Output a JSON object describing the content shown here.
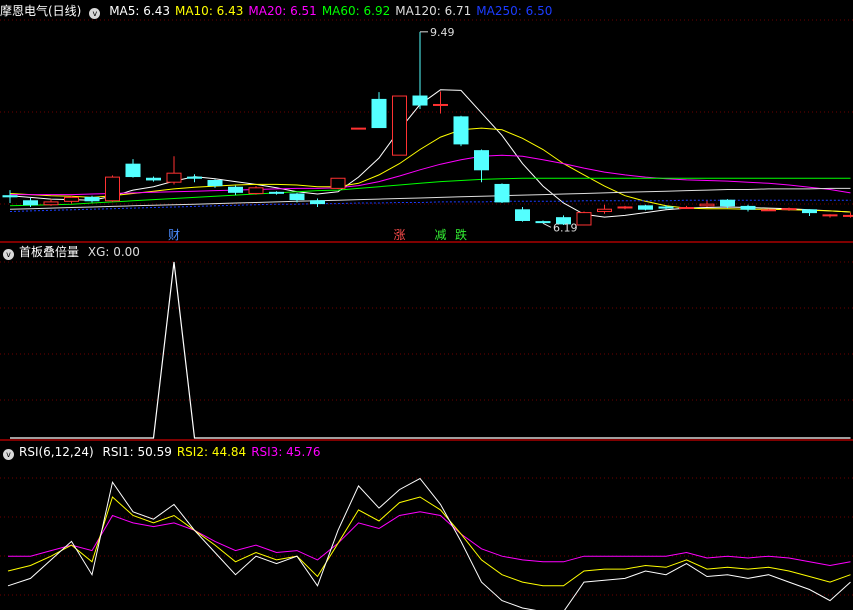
{
  "panels": {
    "main": {
      "title": "摩恩电气(日线)",
      "indicators": [
        {
          "label": "MA5:",
          "value": "6.43",
          "color": "#ffffff"
        },
        {
          "label": "MA10:",
          "value": "6.43",
          "color": "#ffff00"
        },
        {
          "label": "MA20:",
          "value": "6.51",
          "color": "#ff00ff"
        },
        {
          "label": "MA60:",
          "value": "6.92",
          "color": "#00ff00"
        },
        {
          "label": "MA120:",
          "value": "6.71",
          "color": "#dddddd"
        },
        {
          "label": "MA250:",
          "value": "6.50",
          "color": "#1c3cff"
        }
      ]
    },
    "volume": {
      "title": "首板叠倍量",
      "indicators": [
        {
          "label": "XG:",
          "value": "0.00",
          "color": "#dddddd"
        }
      ]
    },
    "rsi": {
      "title": "RSI(6,12,24)",
      "indicators": [
        {
          "label": "RSI1:",
          "value": "50.59",
          "color": "#ffffff"
        },
        {
          "label": "RSI2:",
          "value": "44.84",
          "color": "#ffff00"
        },
        {
          "label": "RSI3:",
          "value": "45.76",
          "color": "#ff00ff"
        }
      ]
    }
  },
  "icons": {
    "collapse": "chevron-down-icon"
  },
  "colors": {
    "up": "#ff3232",
    "down": "#54ffff",
    "grid": "#6e0000",
    "border": "#aa0000"
  },
  "chart_data": [
    {
      "type": "candlestick",
      "ylim": [
        5.9,
        9.7
      ],
      "candles": [
        [
          6.58,
          6.56,
          6.68,
          6.45
        ],
        [
          6.49,
          6.42,
          6.54,
          6.38
        ],
        [
          6.42,
          6.47,
          6.52,
          6.4
        ],
        [
          6.48,
          6.55,
          6.58,
          6.44
        ],
        [
          6.55,
          6.49,
          6.58,
          6.46
        ],
        [
          6.49,
          6.91,
          6.94,
          6.47
        ],
        [
          7.14,
          6.92,
          7.23,
          6.9
        ],
        [
          6.89,
          6.86,
          6.92,
          6.83
        ],
        [
          6.82,
          6.98,
          7.28,
          6.78
        ],
        [
          6.91,
          6.89,
          6.96,
          6.82
        ],
        [
          6.85,
          6.76,
          6.87,
          6.72
        ],
        [
          6.73,
          6.64,
          6.76,
          6.59
        ],
        [
          6.62,
          6.72,
          6.75,
          6.6
        ],
        [
          6.64,
          6.63,
          6.66,
          6.6
        ],
        [
          6.61,
          6.51,
          6.63,
          6.46
        ],
        [
          6.49,
          6.44,
          6.53,
          6.38
        ],
        [
          6.71,
          6.89,
          6.89,
          6.7
        ],
        [
          7.78,
          7.78,
          7.78,
          7.78
        ],
        [
          8.29,
          7.79,
          8.42,
          7.79
        ],
        [
          7.3,
          8.35,
          8.35,
          7.3
        ],
        [
          8.35,
          8.19,
          9.49,
          8.12
        ],
        [
          8.2,
          8.2,
          8.43,
          8.04
        ],
        [
          7.98,
          7.5,
          8.0,
          7.46
        ],
        [
          7.38,
          7.04,
          7.4,
          6.82
        ],
        [
          6.78,
          6.47,
          6.8,
          6.45
        ],
        [
          6.33,
          6.14,
          6.38,
          6.12
        ],
        [
          6.12,
          6.11,
          6.14,
          6.09
        ],
        [
          6.19,
          6.08,
          6.23,
          6.06
        ],
        [
          6.06,
          6.28,
          6.3,
          6.05
        ],
        [
          6.3,
          6.34,
          6.42,
          6.26
        ],
        [
          6.38,
          6.38,
          6.4,
          6.34
        ],
        [
          6.4,
          6.34,
          6.42,
          6.32
        ],
        [
          6.38,
          6.36,
          6.41,
          6.34
        ],
        [
          6.37,
          6.37,
          6.4,
          6.35
        ],
        [
          6.4,
          6.43,
          6.49,
          6.38
        ],
        [
          6.5,
          6.4,
          6.52,
          6.36
        ],
        [
          6.39,
          6.34,
          6.42,
          6.3
        ],
        [
          6.33,
          6.33,
          6.35,
          6.31
        ],
        [
          6.34,
          6.35,
          6.37,
          6.31
        ],
        [
          6.33,
          6.28,
          6.34,
          6.22
        ],
        [
          6.23,
          6.24,
          6.25,
          6.19
        ],
        [
          6.22,
          6.23,
          6.28,
          6.19
        ]
      ],
      "ma": [
        {
          "name": "MA5",
          "color": "#ffffff",
          "values": [
            6.58,
            6.55,
            6.52,
            6.51,
            6.5,
            6.57,
            6.68,
            6.74,
            6.84,
            6.92,
            6.88,
            6.83,
            6.78,
            6.72,
            6.65,
            6.61,
            6.65,
            6.91,
            7.25,
            7.75,
            8.2,
            8.46,
            8.45,
            8.05,
            7.65,
            7.15,
            6.75,
            6.45,
            6.25,
            6.2,
            6.23,
            6.28,
            6.33,
            6.36,
            6.37,
            6.38,
            6.37,
            6.36,
            6.35,
            6.33,
            6.31,
            6.29
          ]
        },
        {
          "name": "MA10",
          "color": "#ffff00",
          "values": [
            6.62,
            6.6,
            6.58,
            6.57,
            6.55,
            6.58,
            6.62,
            6.66,
            6.7,
            6.73,
            6.75,
            6.77,
            6.78,
            6.78,
            6.77,
            6.74,
            6.74,
            6.8,
            6.95,
            7.15,
            7.4,
            7.62,
            7.75,
            7.78,
            7.75,
            7.6,
            7.4,
            7.15,
            6.95,
            6.75,
            6.58,
            6.48,
            6.4,
            6.36,
            6.35,
            6.35,
            6.34,
            6.34,
            6.33,
            6.32,
            6.31,
            6.29
          ]
        },
        {
          "name": "MA20",
          "color": "#ff00ff",
          "values": [
            6.6,
            6.6,
            6.6,
            6.6,
            6.61,
            6.62,
            6.63,
            6.64,
            6.65,
            6.66,
            6.67,
            6.68,
            6.69,
            6.7,
            6.71,
            6.71,
            6.72,
            6.76,
            6.83,
            6.93,
            7.04,
            7.14,
            7.22,
            7.28,
            7.3,
            7.28,
            7.22,
            7.15,
            7.07,
            7.0,
            6.95,
            6.91,
            6.88,
            6.86,
            6.85,
            6.84,
            6.82,
            6.8,
            6.77,
            6.73,
            6.69,
            6.63
          ]
        },
        {
          "name": "MA60",
          "color": "#00ff00",
          "values": [
            6.4,
            6.41,
            6.42,
            6.43,
            6.45,
            6.47,
            6.49,
            6.51,
            6.53,
            6.55,
            6.57,
            6.59,
            6.61,
            6.63,
            6.65,
            6.67,
            6.68,
            6.71,
            6.74,
            6.77,
            6.8,
            6.83,
            6.85,
            6.87,
            6.88,
            6.89,
            6.89,
            6.89,
            6.89,
            6.89,
            6.89,
            6.89,
            6.89,
            6.89,
            6.89,
            6.89,
            6.89,
            6.89,
            6.89,
            6.89,
            6.89,
            6.89
          ]
        },
        {
          "name": "MA120",
          "color": "#dddddd",
          "values": [
            6.34,
            6.35,
            6.36,
            6.37,
            6.38,
            6.39,
            6.4,
            6.41,
            6.42,
            6.43,
            6.44,
            6.45,
            6.46,
            6.47,
            6.48,
            6.49,
            6.5,
            6.51,
            6.52,
            6.53,
            6.54,
            6.55,
            6.56,
            6.57,
            6.58,
            6.59,
            6.6,
            6.61,
            6.62,
            6.63,
            6.64,
            6.65,
            6.66,
            6.67,
            6.68,
            6.69,
            6.69,
            6.7,
            6.7,
            6.7,
            6.71,
            6.71
          ]
        },
        {
          "name": "MA250",
          "color": "#1c3cff",
          "values": [
            6.3,
            6.31,
            6.32,
            6.33,
            6.34,
            6.35,
            6.36,
            6.37,
            6.38,
            6.39,
            6.4,
            6.41,
            6.42,
            6.43,
            6.43,
            6.44,
            6.44,
            6.45,
            6.45,
            6.46,
            6.46,
            6.47,
            6.47,
            6.47,
            6.48,
            6.48,
            6.48,
            6.48,
            6.49,
            6.49,
            6.49,
            6.49,
            6.49,
            6.5,
            6.5,
            6.5,
            6.5,
            6.5,
            6.5,
            6.5,
            6.5,
            6.5
          ]
        }
      ],
      "annotations": [
        {
          "text": "9.49",
          "index": 20,
          "price": 9.49,
          "color": "#dddddd"
        },
        {
          "text": "6.19",
          "index": 26,
          "price": 6.09,
          "color": "#dddddd"
        }
      ],
      "markers": [
        {
          "text": "财",
          "index": 8,
          "color": "#4b8cff"
        },
        {
          "text": "涨",
          "index": 19,
          "color": "#ff4c4c"
        },
        {
          "text": "减",
          "index": 21,
          "color": "#33ee33"
        },
        {
          "text": "跌",
          "index": 22,
          "color": "#33ee33"
        }
      ]
    },
    {
      "type": "line",
      "ylim": [
        0,
        1
      ],
      "series": [
        {
          "name": "XG",
          "color": "#ffffff",
          "values": [
            0,
            0,
            0,
            0,
            0,
            0,
            0,
            0,
            1,
            0,
            0,
            0,
            0,
            0,
            0,
            0,
            0,
            0,
            0,
            0,
            0,
            0,
            0,
            0,
            0,
            0,
            0,
            0,
            0,
            0,
            0,
            0,
            0,
            0,
            0,
            0,
            0,
            0,
            0,
            0,
            0,
            0
          ]
        }
      ]
    },
    {
      "type": "line",
      "ylim": [
        10,
        90
      ],
      "series": [
        {
          "name": "RSI1",
          "color": "#ffffff",
          "values": [
            22,
            26,
            36,
            46,
            28,
            78,
            62,
            58,
            66,
            52,
            40,
            28,
            38,
            34,
            38,
            22,
            52,
            76,
            64,
            74,
            80,
            66,
            46,
            24,
            14,
            10,
            8,
            8,
            24,
            25,
            26,
            30,
            28,
            34,
            27,
            28,
            26,
            28,
            24,
            20,
            14,
            24
          ]
        },
        {
          "name": "RSI2",
          "color": "#ffff00",
          "values": [
            30,
            33,
            38,
            44,
            35,
            70,
            60,
            56,
            60,
            52,
            44,
            35,
            40,
            36,
            38,
            27,
            45,
            63,
            57,
            67,
            70,
            63,
            50,
            36,
            28,
            24,
            22,
            22,
            30,
            31,
            31,
            33,
            32,
            36,
            31,
            32,
            31,
            32,
            30,
            27,
            24,
            28
          ]
        },
        {
          "name": "RSI3",
          "color": "#ff00ff",
          "values": [
            38,
            38,
            41,
            44,
            41,
            60,
            56,
            54,
            56,
            52,
            46,
            41,
            44,
            40,
            41,
            36,
            45,
            56,
            53,
            60,
            62,
            60,
            50,
            42,
            38,
            36,
            35,
            35,
            38,
            38,
            38,
            38,
            38,
            40,
            37,
            38,
            37,
            38,
            37,
            35,
            33,
            35
          ]
        }
      ]
    }
  ]
}
